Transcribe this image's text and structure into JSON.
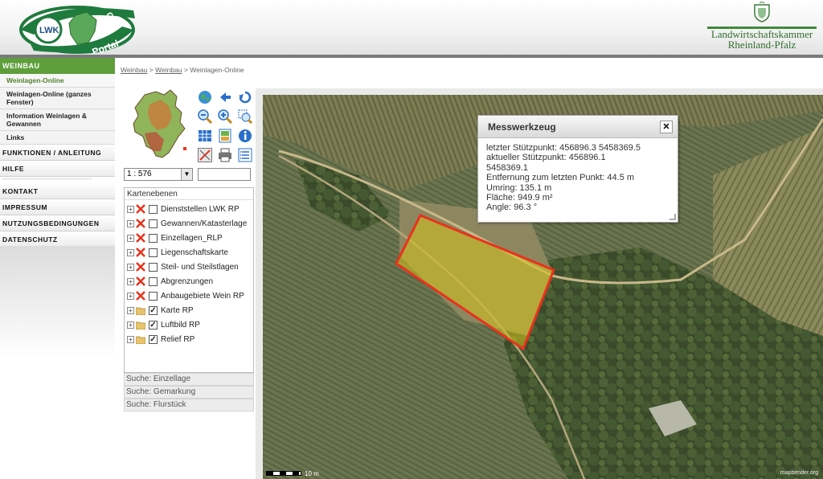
{
  "header": {
    "logo_text_lwk": "LWK",
    "logo_text_geo": "Geo",
    "logo_text_portal": "Portal",
    "org_line1": "Landwirtschaftskammer",
    "org_line2": "Rheinland-Pfalz"
  },
  "sidebar": {
    "section": "WEINBAU",
    "sub_items": [
      "Weinlagen-Online",
      "Weinlagen-Online (ganzes Fenster)",
      "Information Weinlagen & Gewannen",
      "Links"
    ],
    "main_items": [
      "FUNKTIONEN / ANLEITUNG",
      "HILFE"
    ],
    "separator": "------------------------------------------------",
    "main_items2": [
      "KONTAKT",
      "IMPRESSUM",
      "NUTZUNGSBEDINGUNGEN",
      "DATENSCHUTZ"
    ]
  },
  "breadcrumb": {
    "links": [
      "Weinbau",
      "Weinbau"
    ],
    "current": "Weinlagen-Online",
    "sep": ">"
  },
  "scale": {
    "value": "1 : 576"
  },
  "layers": {
    "title": "Kartenebenen",
    "items": [
      {
        "label": "Dienststellen LWK RP",
        "checked": false
      },
      {
        "label": "Gewannen/Katasterlage",
        "checked": false
      },
      {
        "label": "Einzellagen_RLP",
        "checked": false
      },
      {
        "label": "Liegenschaftskarte",
        "checked": false
      },
      {
        "label": "Steil- und Steilstlagen",
        "checked": false
      },
      {
        "label": "Abgrenzungen",
        "checked": false
      },
      {
        "label": "Anbaugebiete Wein RP",
        "checked": false
      },
      {
        "label": "Karte RP",
        "checked": true
      },
      {
        "label": "Luftbild RP",
        "checked": true
      },
      {
        "label": "Relief RP",
        "checked": true
      }
    ]
  },
  "searches": [
    "Suche: Einzellage",
    "Suche: Gemarkung",
    "Suche: Flurstück"
  ],
  "map": {
    "credit": "mapbender.org",
    "scalebar_label": "10 m"
  },
  "dialog": {
    "title": "Messwerkzeug",
    "close": "✕",
    "line1": "letzter Stützpunkt: 456896.3 5458369.5",
    "line2": "aktueller Stützpunkt: 456896.1",
    "line3": "5458369.1",
    "line4": "Entfernung zum letzten Punkt: 44.5 m",
    "line5": "Umring: 135.1 m",
    "line6": "Fläche: 949.9 m²",
    "line7": "Angle: 96.3 °"
  },
  "colors": {
    "green": "#5e9e3b",
    "measure_red": "#e8321e",
    "measure_fill": "#d6c21c"
  },
  "icons": [
    "globe-icon",
    "pan-back-icon",
    "undo-icon",
    "zoom-out-icon",
    "zoom-in-icon",
    "zoom-box-icon",
    "grid-icon",
    "legend-icon",
    "info-icon",
    "measure-icon",
    "print-icon",
    "list-icon"
  ]
}
